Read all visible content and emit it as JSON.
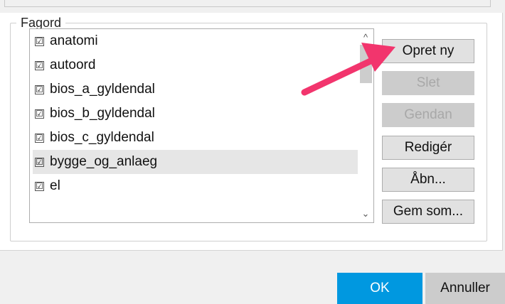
{
  "group": {
    "legend": "Fagord"
  },
  "list": {
    "items": [
      {
        "label": "anatomi",
        "checked": true,
        "check_glyph": "☑"
      },
      {
        "label": "autoord",
        "checked": true,
        "check_glyph": "☑"
      },
      {
        "label": "bios_a_gyldendal",
        "checked": true,
        "check_glyph": "☑"
      },
      {
        "label": "bios_b_gyldendal",
        "checked": true,
        "check_glyph": "☑"
      },
      {
        "label": "bios_c_gyldendal",
        "checked": true,
        "check_glyph": "☑"
      },
      {
        "label": "bygge_og_anlaeg",
        "checked": true,
        "check_glyph": "☑",
        "selected": true
      },
      {
        "label": "el",
        "checked": true,
        "check_glyph": "☑"
      }
    ],
    "scroll_up_glyph": "^",
    "scroll_down_glyph": "⌄"
  },
  "buttons": {
    "create_new": "Opret ny",
    "delete": "Slet",
    "restore": "Gendan",
    "edit": "Redigér",
    "open": "Åbn...",
    "save_as": "Gem som..."
  },
  "dialog": {
    "ok": "OK",
    "cancel": "Annuller"
  },
  "colors": {
    "accent": "#0098e0",
    "annotation_arrow": "#f2356d"
  }
}
